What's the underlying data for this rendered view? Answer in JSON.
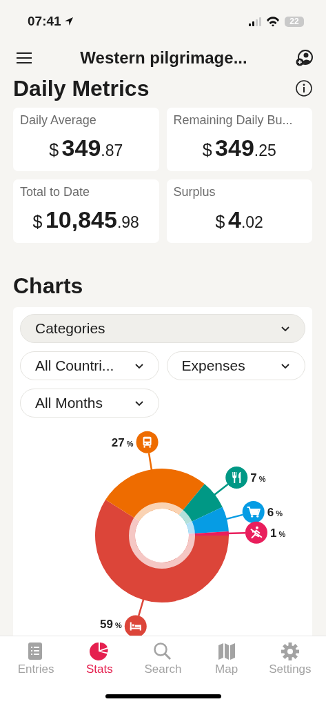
{
  "status_bar": {
    "time": "07:41",
    "battery": "22"
  },
  "header": {
    "title": "Western pilgrimage..."
  },
  "metrics": {
    "title": "Daily Metrics",
    "cards": [
      {
        "label": "Daily Average",
        "currency": "$",
        "whole": "349",
        "cents": ".87"
      },
      {
        "label": "Remaining Daily Bu...",
        "currency": "$",
        "whole": "349",
        "cents": ".25"
      },
      {
        "label": "Total to Date",
        "currency": "$",
        "whole": "10,845",
        "cents": ".98"
      },
      {
        "label": "Surplus",
        "currency": "$",
        "whole": "4",
        "cents": ".02"
      }
    ]
  },
  "charts": {
    "title": "Charts",
    "filters": [
      {
        "label": "Categories",
        "wide": true
      },
      {
        "label": "All Countri...",
        "wide": false
      },
      {
        "label": "Expenses",
        "wide": false
      },
      {
        "label": "All Months",
        "wide": false
      }
    ],
    "slices": [
      {
        "kind": "bed"
      },
      {
        "kind": "bus"
      },
      {
        "kind": "food"
      },
      {
        "kind": "cart"
      },
      {
        "kind": "activity"
      }
    ],
    "chart_data": {
      "type": "donut",
      "values": [
        59,
        27,
        7,
        6,
        1
      ],
      "colors": [
        "#dc4539",
        "#ee6c00",
        "#009885",
        "#069ce4",
        "#e91e5c"
      ],
      "value_labels": [
        "59 %",
        "27 %",
        "7 %",
        "6 %",
        "1 %"
      ]
    }
  },
  "tab_bar": [
    {
      "label": "Entries",
      "kind": "list",
      "selected": false
    },
    {
      "label": "Stats",
      "kind": "pie",
      "selected": true
    },
    {
      "label": "Search",
      "kind": "search",
      "selected": false
    },
    {
      "label": "Map",
      "kind": "map",
      "selected": false
    },
    {
      "label": "Settings",
      "kind": "gear",
      "selected": false
    }
  ]
}
